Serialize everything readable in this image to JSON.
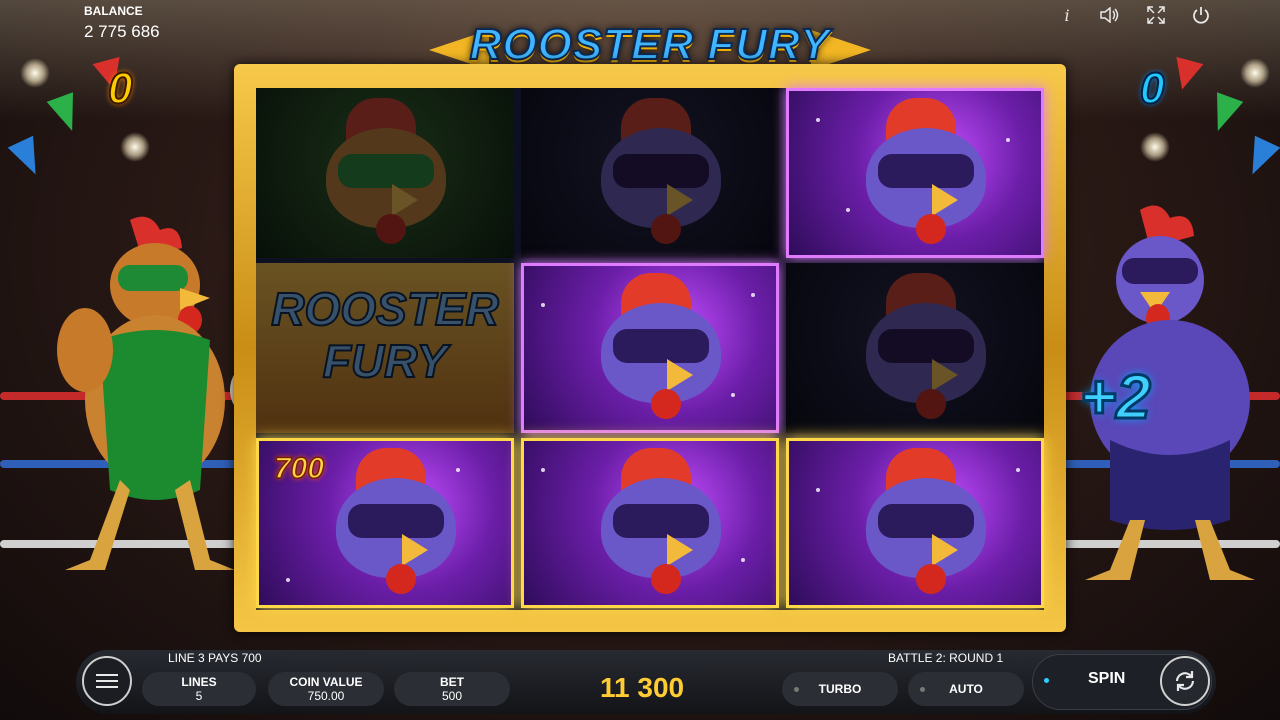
{
  "game": {
    "title": "ROOSTER FURY"
  },
  "balance": {
    "label": "BALANCE",
    "value": "2 775 686"
  },
  "scores": {
    "left": "0",
    "right": "0"
  },
  "top_icons": [
    "info-icon",
    "sound-icon",
    "fullscreen-icon",
    "power-icon"
  ],
  "top_icon_glyphs": {
    "info": "i",
    "sound": "◁",
    "fullscreen": "⤢",
    "power": "⏻"
  },
  "reels": {
    "rows": [
      [
        {
          "symbol": "green-rooster",
          "state": "dim"
        },
        {
          "symbol": "purple-rooster",
          "state": "dim"
        },
        {
          "symbol": "purple-rooster",
          "state": "highlight"
        }
      ],
      [
        {
          "symbol": "rooster-fury-logo",
          "state": "dim",
          "text_line1": "ROOSTER",
          "text_line2": "FURY"
        },
        {
          "symbol": "purple-rooster",
          "state": "highlight"
        },
        {
          "symbol": "purple-rooster",
          "state": "dim"
        }
      ],
      [
        {
          "symbol": "purple-rooster",
          "state": "win",
          "win_amount": "700"
        },
        {
          "symbol": "purple-rooster",
          "state": "win"
        },
        {
          "symbol": "purple-rooster",
          "state": "win"
        }
      ]
    ]
  },
  "fighter_bonus": "+2",
  "bottom": {
    "line_info": "LINE 3 PAYS 700",
    "battle_info": "BATTLE 2: ROUND 1",
    "lines": {
      "label": "LINES",
      "value": "5"
    },
    "coin_value": {
      "label": "COIN VALUE",
      "value": "750.00"
    },
    "bet": {
      "label": "BET",
      "value": "500"
    },
    "win_total": "11 300",
    "turbo": "TURBO",
    "auto": "AUTO",
    "spin": "SPIN"
  },
  "colors": {
    "accent_gold": "#ffd84a",
    "accent_blue": "#3fb6ff",
    "win_text": "#ffcc33"
  }
}
